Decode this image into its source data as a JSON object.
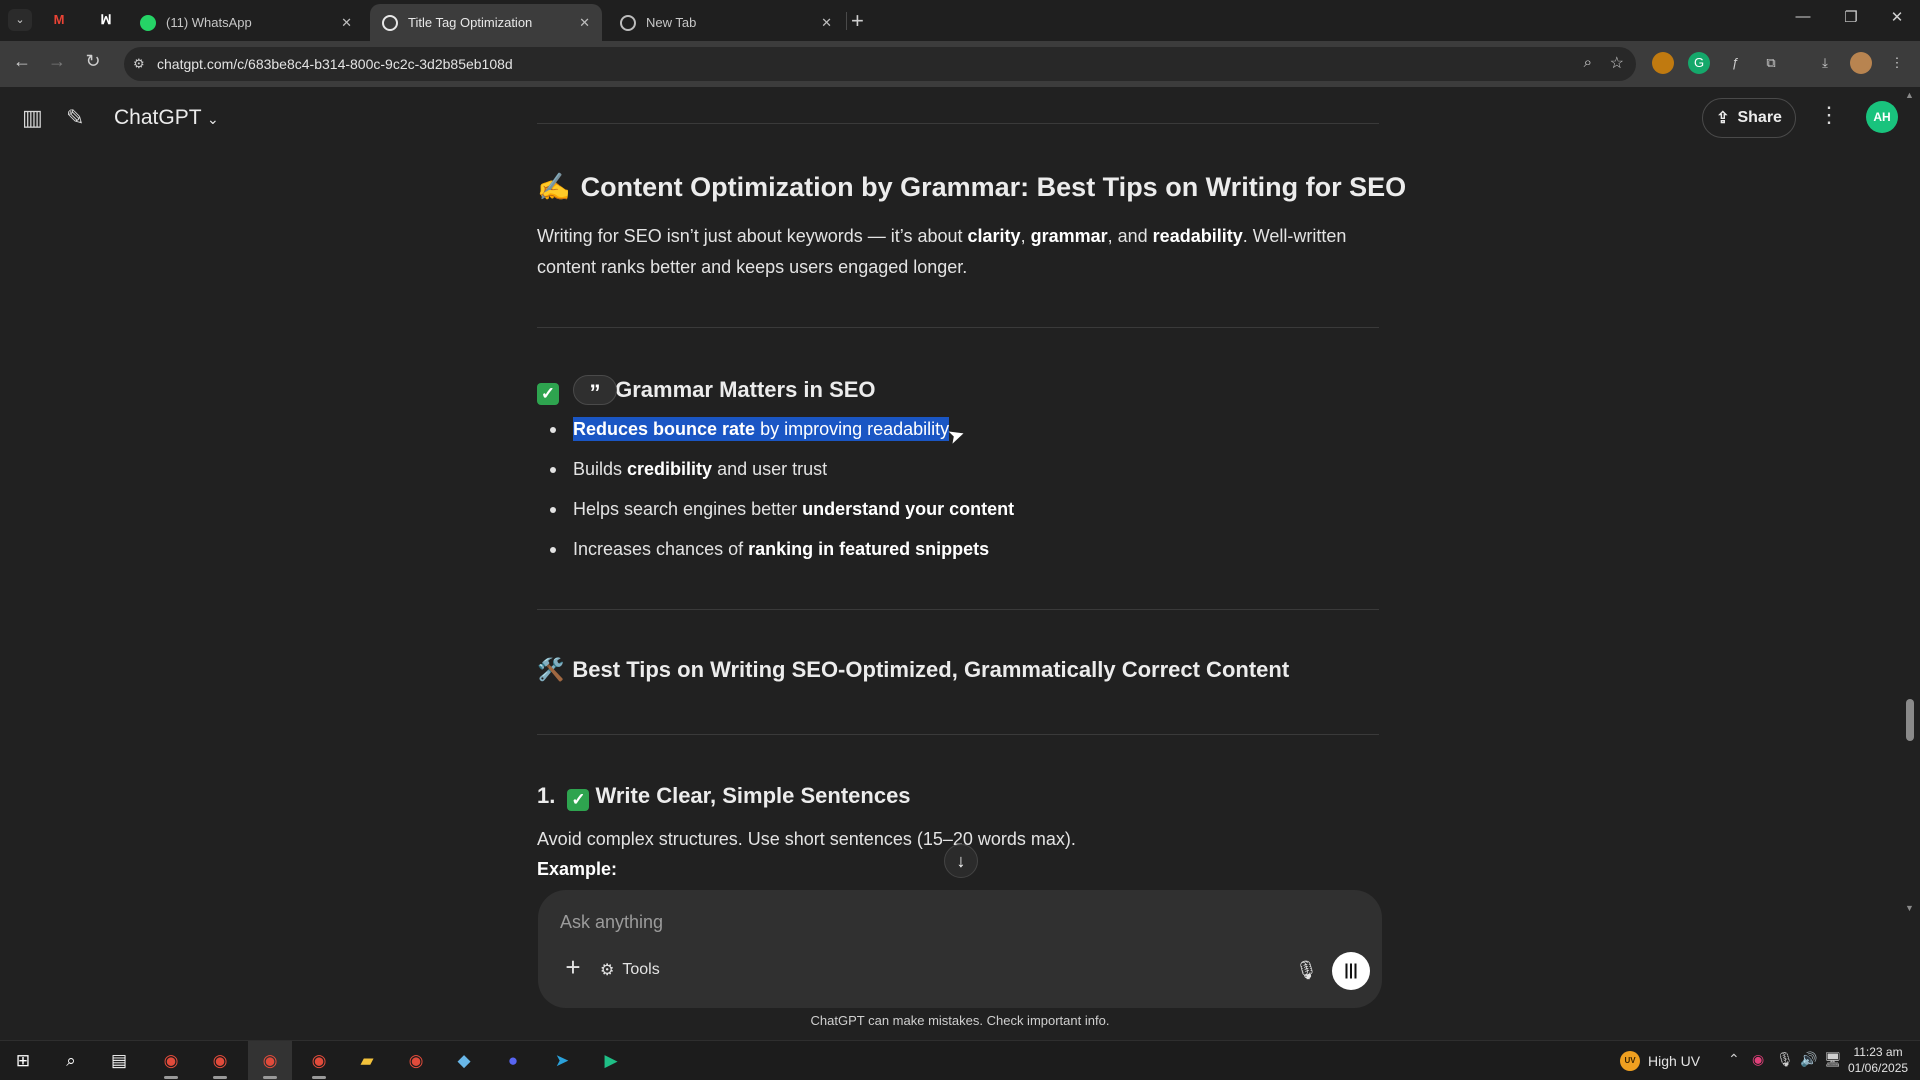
{
  "browser": {
    "tabs": [
      {
        "title": "(11) WhatsApp",
        "active": false
      },
      {
        "title": "Title Tag Optimization",
        "active": true
      },
      {
        "title": "New Tab",
        "active": false
      }
    ],
    "url": "chatgpt.com/c/683be8c4-b314-800c-9c2c-3d2b85eb108d"
  },
  "header": {
    "model": "ChatGPT",
    "share_label": "Share",
    "avatar_initials": "AH"
  },
  "content": {
    "section1_icon": "✍️",
    "section1_title": "Content Optimization by Grammar: Best Tips on Writing for SEO",
    "intro": {
      "t1": "Writing for SEO isn’t just about keywords — it’s about ",
      "b1": "clarity",
      "t2": ", ",
      "b2": "grammar",
      "t3": ", and ",
      "b3": "readability",
      "t4": ". Well-written content ranks better and keeps users engaged longer."
    },
    "why_title_lead": "",
    "why_title": "Grammar Matters in SEO",
    "quote_mark": "”",
    "bullets": [
      {
        "bold": "Reduces bounce rate",
        "rest": " by improving readability"
      },
      {
        "pre": "Builds ",
        "bold": "credibility",
        "rest": " and user trust"
      },
      {
        "pre": "Helps search engines better ",
        "bold": "understand your content"
      },
      {
        "pre": "Increases chances of ",
        "bold": "ranking in featured snippets"
      }
    ],
    "section2_icon": "🛠️",
    "section2_title": "Best Tips on Writing SEO-Optimized, Grammatically Correct Content",
    "tip1_number": "1.",
    "tip1_title": "Write Clear, Simple Sentences",
    "tip1_text": "Avoid complex structures. Use short sentences (15–20 words max).",
    "example_label": "Example:"
  },
  "composer": {
    "placeholder": "Ask anything",
    "tools_label": "Tools"
  },
  "disclaimer": "ChatGPT can make mistakes. Check important info.",
  "taskbar": {
    "weather": "High UV",
    "weather_badge": "UV",
    "time": "11:23 am",
    "date": "01/06/2025"
  }
}
